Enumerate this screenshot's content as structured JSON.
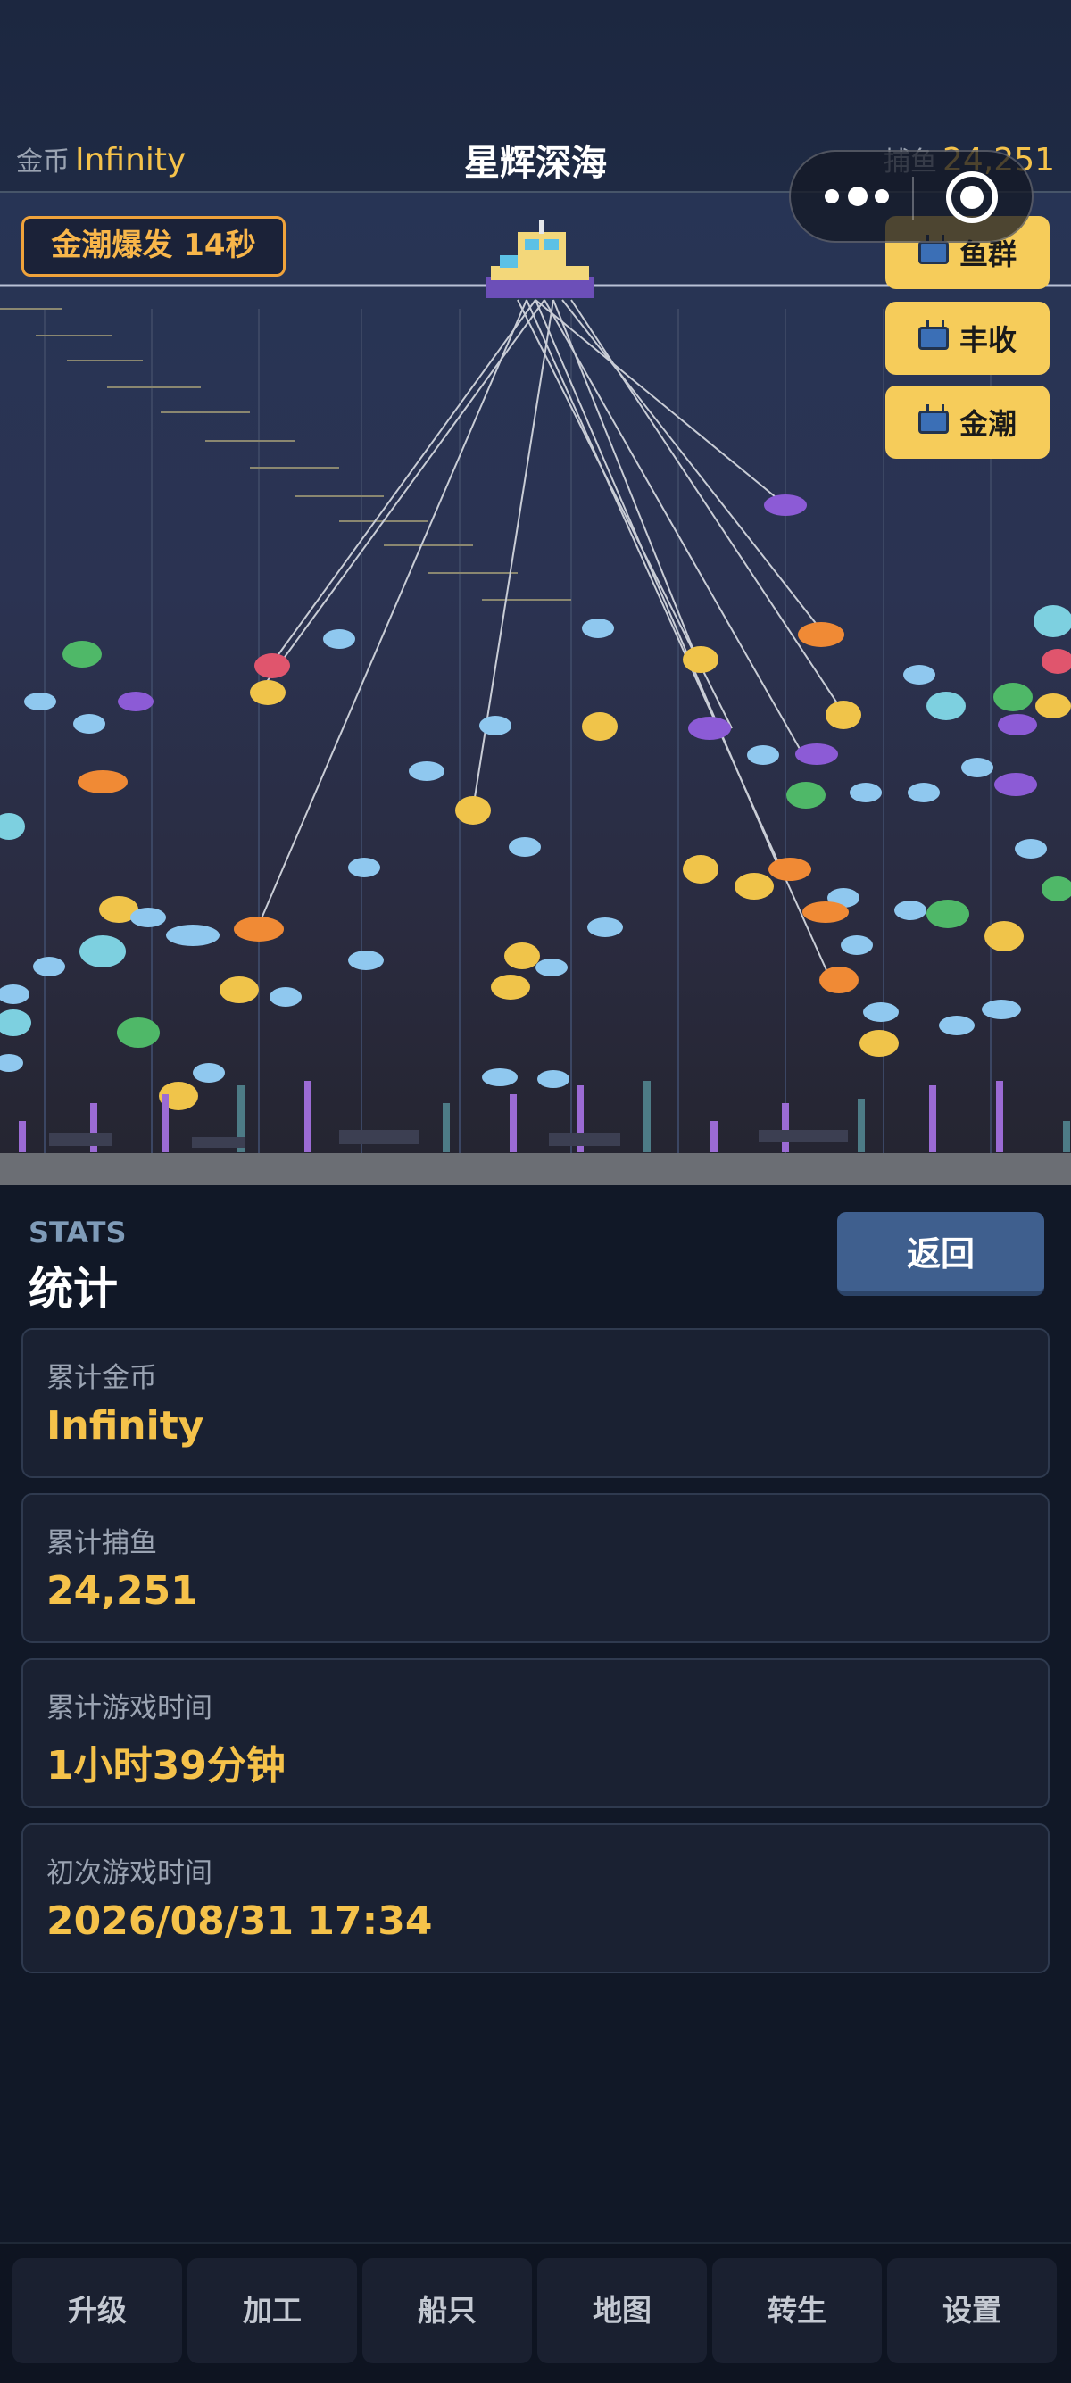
{
  "header": {
    "coins_label": "金币",
    "coins_value": "Infinity",
    "title": "星辉深海",
    "fish_label": "捕鱼",
    "fish_value": "24,251"
  },
  "event_badge": "金潮爆发 14秒",
  "ad_buttons": [
    {
      "label": "鱼群",
      "icon": "tv-icon"
    },
    {
      "label": "丰收",
      "icon": "tv-icon"
    },
    {
      "label": "金潮",
      "icon": "tv-icon"
    }
  ],
  "stats": {
    "heading_en": "STATS",
    "heading_zh": "统计",
    "back_label": "返回",
    "items": [
      {
        "label": "累计金币",
        "value": "Infinity"
      },
      {
        "label": "累计捕鱼",
        "value": "24,251"
      },
      {
        "label": "累计游戏时间",
        "value": "1小时39分钟"
      },
      {
        "label": "初次游戏时间",
        "value": "2026/08/31 17:34"
      }
    ]
  },
  "nav": [
    "升级",
    "加工",
    "船只",
    "地图",
    "转生",
    "设置"
  ],
  "colors": {
    "gold": "#f5c24a",
    "accent_orange": "#f0a33b",
    "button_blue": "#3f5f8e",
    "ad_yellow": "#f6cc5a"
  }
}
